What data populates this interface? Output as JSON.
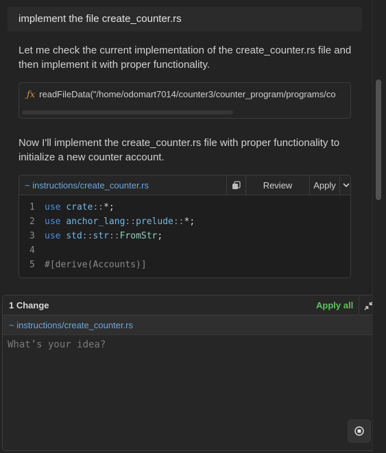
{
  "user_message": "implement the file create_counter.rs",
  "assistant": {
    "paragraph_1": "Let me check the current implementation of the create_counter.rs file and then implement it with proper functionality.",
    "tool_call": {
      "icon": "function-icon",
      "text": "readFileData(\"/home/odomart7014/counter3/counter_program/programs/co"
    },
    "paragraph_2": "Now I'll implement the create_counter.rs file with proper functionality to initialize a new counter account."
  },
  "code_block": {
    "file_label": "~ instructions/create_counter.rs",
    "review_label": "Review",
    "apply_label": "Apply",
    "lines": [
      {
        "n": "1",
        "parts": [
          [
            "use ",
            "kw"
          ],
          [
            "crate",
            "ty"
          ],
          [
            "::",
            "op"
          ],
          [
            "*;",
            "plain"
          ]
        ]
      },
      {
        "n": "2",
        "parts": [
          [
            "use ",
            "kw"
          ],
          [
            "anchor_lang",
            "ty"
          ],
          [
            "::",
            "op"
          ],
          [
            "prelude",
            "ty"
          ],
          [
            "::",
            "op"
          ],
          [
            "*;",
            "plain"
          ]
        ]
      },
      {
        "n": "3",
        "parts": [
          [
            "use ",
            "kw"
          ],
          [
            "std",
            "ty"
          ],
          [
            "::",
            "op"
          ],
          [
            "str",
            "ty"
          ],
          [
            "::",
            "op"
          ],
          [
            "FromStr",
            "cls"
          ],
          [
            ";",
            "plain"
          ]
        ]
      },
      {
        "n": "4",
        "parts": []
      },
      {
        "n": "5",
        "parts": [
          [
            "#[derive(Accounts)]",
            "attr"
          ]
        ]
      }
    ]
  },
  "composer": {
    "changes_title": "1 Change",
    "apply_all_label": "Apply all",
    "file_label": "~ instructions/create_counter.rs",
    "input_value": "",
    "input_placeholder": "What’s your idea?"
  },
  "colors": {
    "accent_link": "#6fa7dd",
    "apply_all": "#5fc25f",
    "keyword": "#4f8fd6"
  }
}
